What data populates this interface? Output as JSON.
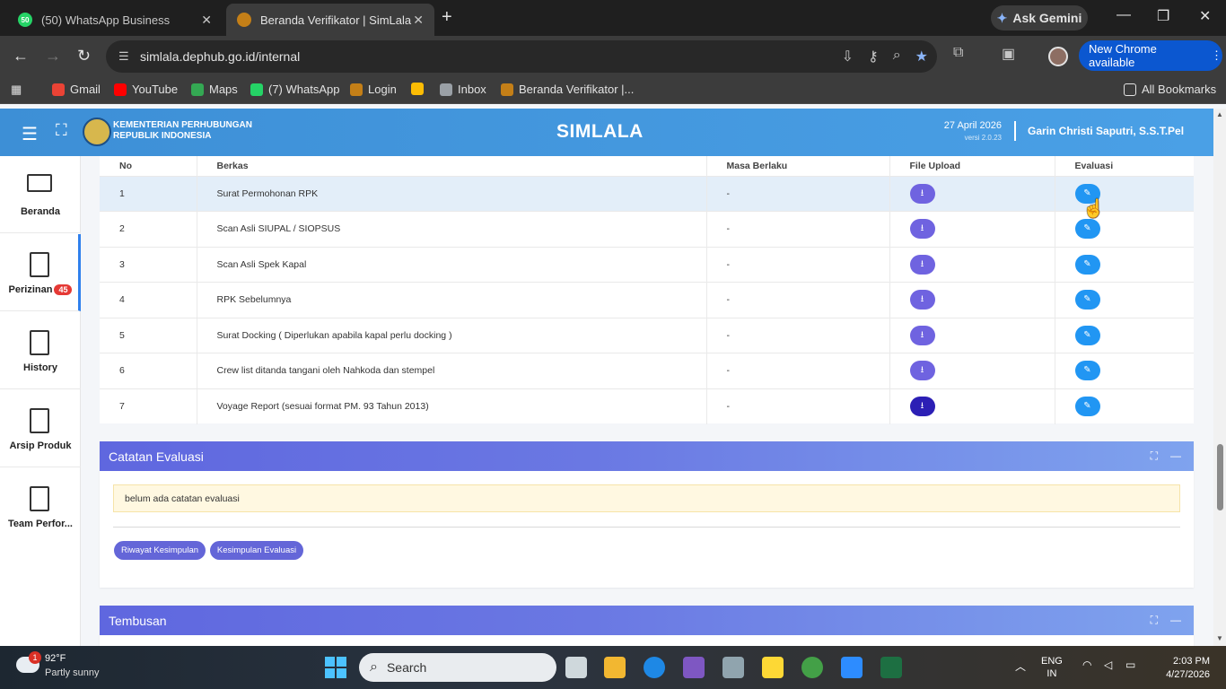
{
  "browser": {
    "tabs": [
      {
        "title": "(50) WhatsApp Business",
        "badge": "50",
        "active": false
      },
      {
        "title": "Beranda Verifikator | SimLala",
        "active": true
      }
    ],
    "new_tab": "+",
    "gemini": "Ask Gemini",
    "window_controls": {
      "minimize": "—",
      "maximize": "❐",
      "close": "✕"
    },
    "url": "simlala.dephub.go.id/internal",
    "new_chrome": "New Chrome available",
    "bookmarks": [
      {
        "label": "Gmail",
        "color": "#ea4335"
      },
      {
        "label": "YouTube",
        "color": "#ff0000"
      },
      {
        "label": "Maps",
        "color": "#34a853"
      },
      {
        "label": "(7) WhatsApp",
        "color": "#25d366"
      },
      {
        "label": "Login",
        "color": "#c47f17"
      },
      {
        "label": "",
        "color": "#fbbc04"
      },
      {
        "label": "Inbox",
        "color": "#9aa0a6"
      },
      {
        "label": "Beranda Verifikator |...",
        "color": "#c47f17"
      }
    ],
    "all_bookmarks": "All Bookmarks"
  },
  "app": {
    "ministry_line1": "KEMENTERIAN PERHUBUNGAN",
    "ministry_line2": "REPUBLIK INDONESIA",
    "title": "SIMLALA",
    "date": "27 April 2026",
    "version": "versi 2.0.23",
    "user": "Garin Christi Saputri, S.S.T.Pel",
    "accent": "#4a9be3"
  },
  "sidebar": {
    "items": [
      {
        "label": "Beranda"
      },
      {
        "label": "Perizinan",
        "badge": "45",
        "active": true
      },
      {
        "label": "History"
      },
      {
        "label": "Arsip Produk"
      },
      {
        "label": "Team Perfor..."
      }
    ]
  },
  "table": {
    "headers": [
      "No",
      "Berkas",
      "Masa Berlaku",
      "File Upload",
      "Evaluasi"
    ],
    "rows": [
      {
        "no": "1",
        "berkas": "Surat Permohonan RPK",
        "masa": "-"
      },
      {
        "no": "2",
        "berkas": "Scan Asli SIUPAL / SIOPSUS",
        "masa": "-"
      },
      {
        "no": "3",
        "berkas": "Scan Asli Spek Kapal",
        "masa": "-"
      },
      {
        "no": "4",
        "berkas": "RPK Sebelumnya",
        "masa": "-"
      },
      {
        "no": "5",
        "berkas": "Surat Docking ( Diperlukan apabila kapal perlu docking )",
        "masa": "-"
      },
      {
        "no": "6",
        "berkas": "Crew list ditanda tangani oleh Nahkoda dan stempel",
        "masa": "-"
      },
      {
        "no": "7",
        "berkas": "Voyage Report (sesuai format PM. 93 Tahun 2013)",
        "masa": "-"
      }
    ]
  },
  "catatan": {
    "title": "Catatan Evaluasi",
    "empty_message": "belum ada catatan evaluasi",
    "btn_riwayat": "Riwayat Kesimpulan",
    "btn_kesimpulan": "Kesimpulan Evaluasi"
  },
  "tembusan": {
    "title": "Tembusan"
  },
  "taskbar": {
    "weather_temp": "92°F",
    "weather_desc": "Partly sunny",
    "weather_badge": "1",
    "search": "Search",
    "lang1": "ENG",
    "lang2": "IN",
    "time": "2:03 PM",
    "date": "4/27/2026"
  }
}
